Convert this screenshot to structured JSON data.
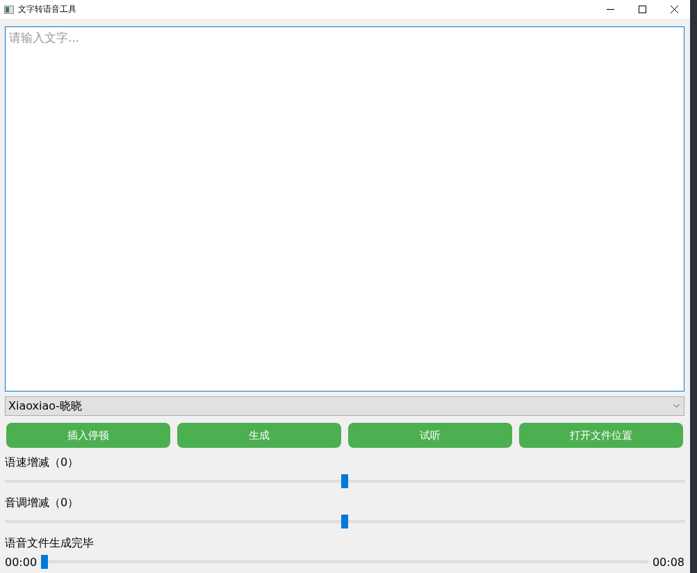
{
  "window": {
    "title": "文字转语音工具"
  },
  "text_input": {
    "placeholder": "请输入文字..."
  },
  "voice_select": {
    "value": "Xiaoxiao-晓晓"
  },
  "buttons": [
    "插入停顿",
    "生成",
    "试听",
    "打开文件位置"
  ],
  "sliders": [
    {
      "label": "语速增减（0）",
      "level": 0.5
    },
    {
      "label": "音调增减（0）",
      "level": 0.5
    }
  ],
  "status": "语音文件生成完毕",
  "playback": {
    "current_time": "00:00",
    "level": 0,
    "total_time": "00:08"
  }
}
